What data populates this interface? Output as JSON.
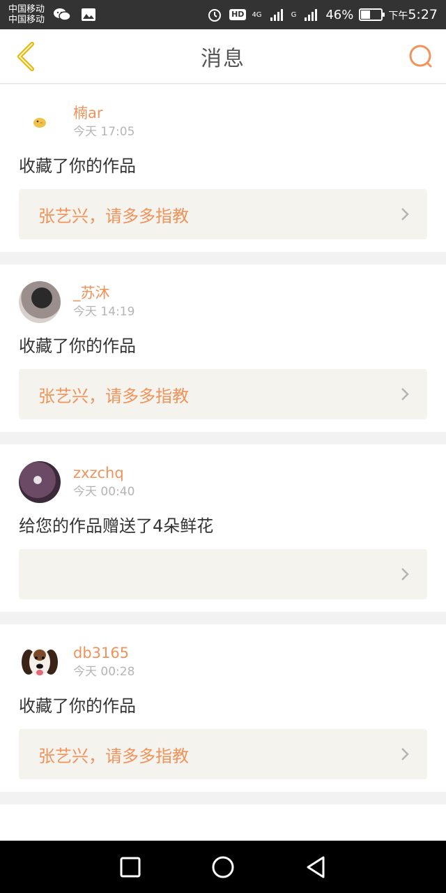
{
  "status_bar": {
    "carrier_1": "中国移动",
    "carrier_2": "中国移动",
    "hd": "HD",
    "network_4g": "4G",
    "network_g": "G",
    "battery_percent": "46%",
    "battery_level": 0.46,
    "time_prefix": "下午",
    "time": "5:27",
    "icons": [
      "wechat-icon",
      "image-icon",
      "alarm-icon",
      "signal-icon",
      "battery-icon"
    ]
  },
  "header": {
    "title": "消息",
    "back_icon": "chevron-left-icon",
    "search_icon": "search-icon"
  },
  "colors": {
    "accent": "#f0935b",
    "back_arrow": "#e8b400",
    "text_primary": "#333333",
    "text_secondary": "#b5b5b5",
    "card_link_bg": "#f4f3ee"
  },
  "messages": [
    {
      "username": "楠ar",
      "time": "今天 17:05",
      "action": "收藏了你的作品",
      "work_title": "张艺兴，请多多指教"
    },
    {
      "username": "_苏沐",
      "time": "今天 14:19",
      "action": "收藏了你的作品",
      "work_title": "张艺兴，请多多指教"
    },
    {
      "username": "zxzchq",
      "time": "今天 00:40",
      "action": "给您的作品赠送了4朵鲜花",
      "work_title": ""
    },
    {
      "username": "db3165",
      "time": "今天 00:28",
      "action": "收藏了你的作品",
      "work_title": "张艺兴，请多多指教"
    }
  ],
  "nav_bar": {
    "icons": [
      "recent-apps-icon",
      "home-icon",
      "back-icon"
    ]
  }
}
